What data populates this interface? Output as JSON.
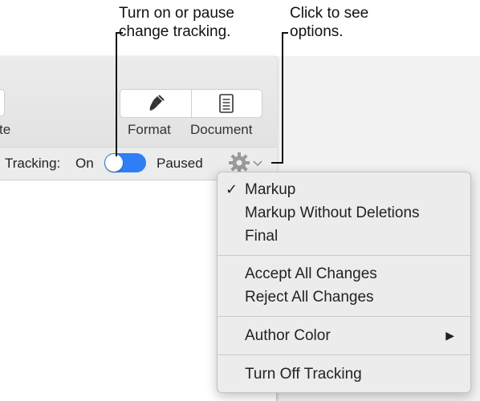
{
  "callouts": {
    "toggle_line1": "Turn on or pause",
    "toggle_line2": "change tracking.",
    "options_line1": "Click to see",
    "options_line2": "options."
  },
  "toolbar": {
    "left_button_label": "te",
    "format_label": "Format",
    "document_label": "Document"
  },
  "tracking": {
    "label": "Tracking:",
    "on_label": "On",
    "paused_label": "Paused",
    "state": "on"
  },
  "menu": {
    "items": [
      {
        "label": "Markup",
        "checked": true
      },
      {
        "label": "Markup Without Deletions",
        "checked": false
      },
      {
        "label": "Final",
        "checked": false
      },
      {
        "label": "Accept All Changes"
      },
      {
        "label": "Reject All Changes"
      },
      {
        "label": "Author Color",
        "submenu": true
      },
      {
        "label": "Turn Off Tracking"
      }
    ],
    "check_glyph": "✓",
    "submenu_glyph": "▶"
  },
  "colors": {
    "toggle_accent": "#2f7ef5",
    "menu_bg": "#ececec",
    "toolbar_bg": "#e6e6e6"
  }
}
